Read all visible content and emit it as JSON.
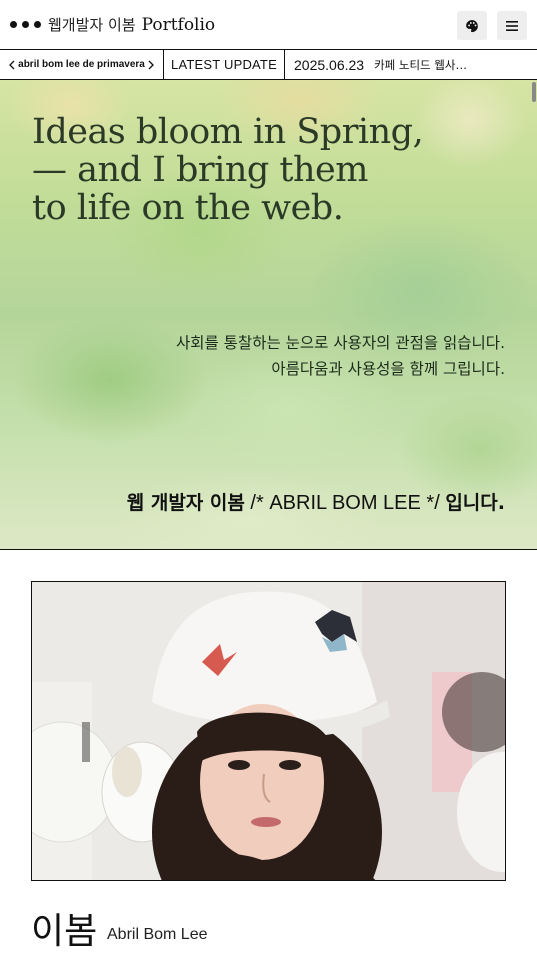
{
  "header": {
    "brand_ko": "웹개발자 이봄",
    "brand_en": "Portfolio",
    "palette_icon": "palette-icon",
    "menu_icon": "hamburger-menu-icon"
  },
  "ticker": {
    "name": "abril bom lee de primavera",
    "latest_label": "LATEST UPDATE",
    "date": "2025.06.23",
    "title": "카페 노티드 웹사…"
  },
  "hero": {
    "title_lines": [
      "Ideas bloom in Spring,",
      "— and I bring them",
      "to life on the web."
    ],
    "desc_lines": [
      "사회를 통찰하는 눈으로 사용자의 관점을 읽습니다.",
      "아름다움과 사용성을 함께 그립니다."
    ],
    "tag_bold": "웹 개발자 이봄",
    "tag_mid": " /* ABRIL BOM LEE */ ",
    "tag_end": "입니다."
  },
  "profile": {
    "name_ko": "이봄",
    "name_en": "Abril Bom Lee"
  },
  "colors": {
    "ink": "#111111",
    "hero_green": "#c2dd98",
    "button_bg": "#eeeeee"
  }
}
